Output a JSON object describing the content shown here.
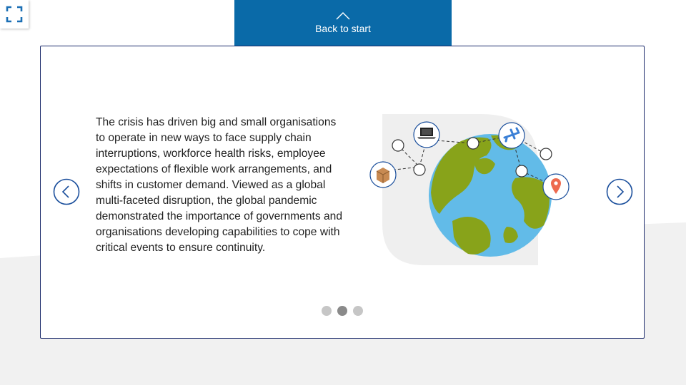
{
  "header": {
    "back_label": "Back to start"
  },
  "slide": {
    "body_text": "The crisis has driven big and small organisations to operate in new ways to face supply chain interruptions, workforce health risks, employee expectations of flexible work arrangements, and shifts in customer demand. Viewed as a global multi-faceted disruption, the global pandemic demonstrated the importance of governments and organisations developing capabilities to cope with critical events to ensure continuity."
  },
  "pagination": {
    "total": 3,
    "current": 2
  },
  "icons": {
    "fullscreen": "fullscreen-icon",
    "back": "chevron-up-icon",
    "prev": "chevron-left-icon",
    "next": "chevron-right-icon",
    "illustration_nodes": [
      "package-icon",
      "laptop-icon",
      "airplane-icon",
      "location-pin-icon"
    ]
  },
  "colors": {
    "brand_blue": "#0a6aa8",
    "card_border": "#1b2a6b",
    "ocean": "#62bbe8",
    "land": "#88a31a",
    "pin": "#ee6a4f",
    "package": "#c88a52"
  }
}
